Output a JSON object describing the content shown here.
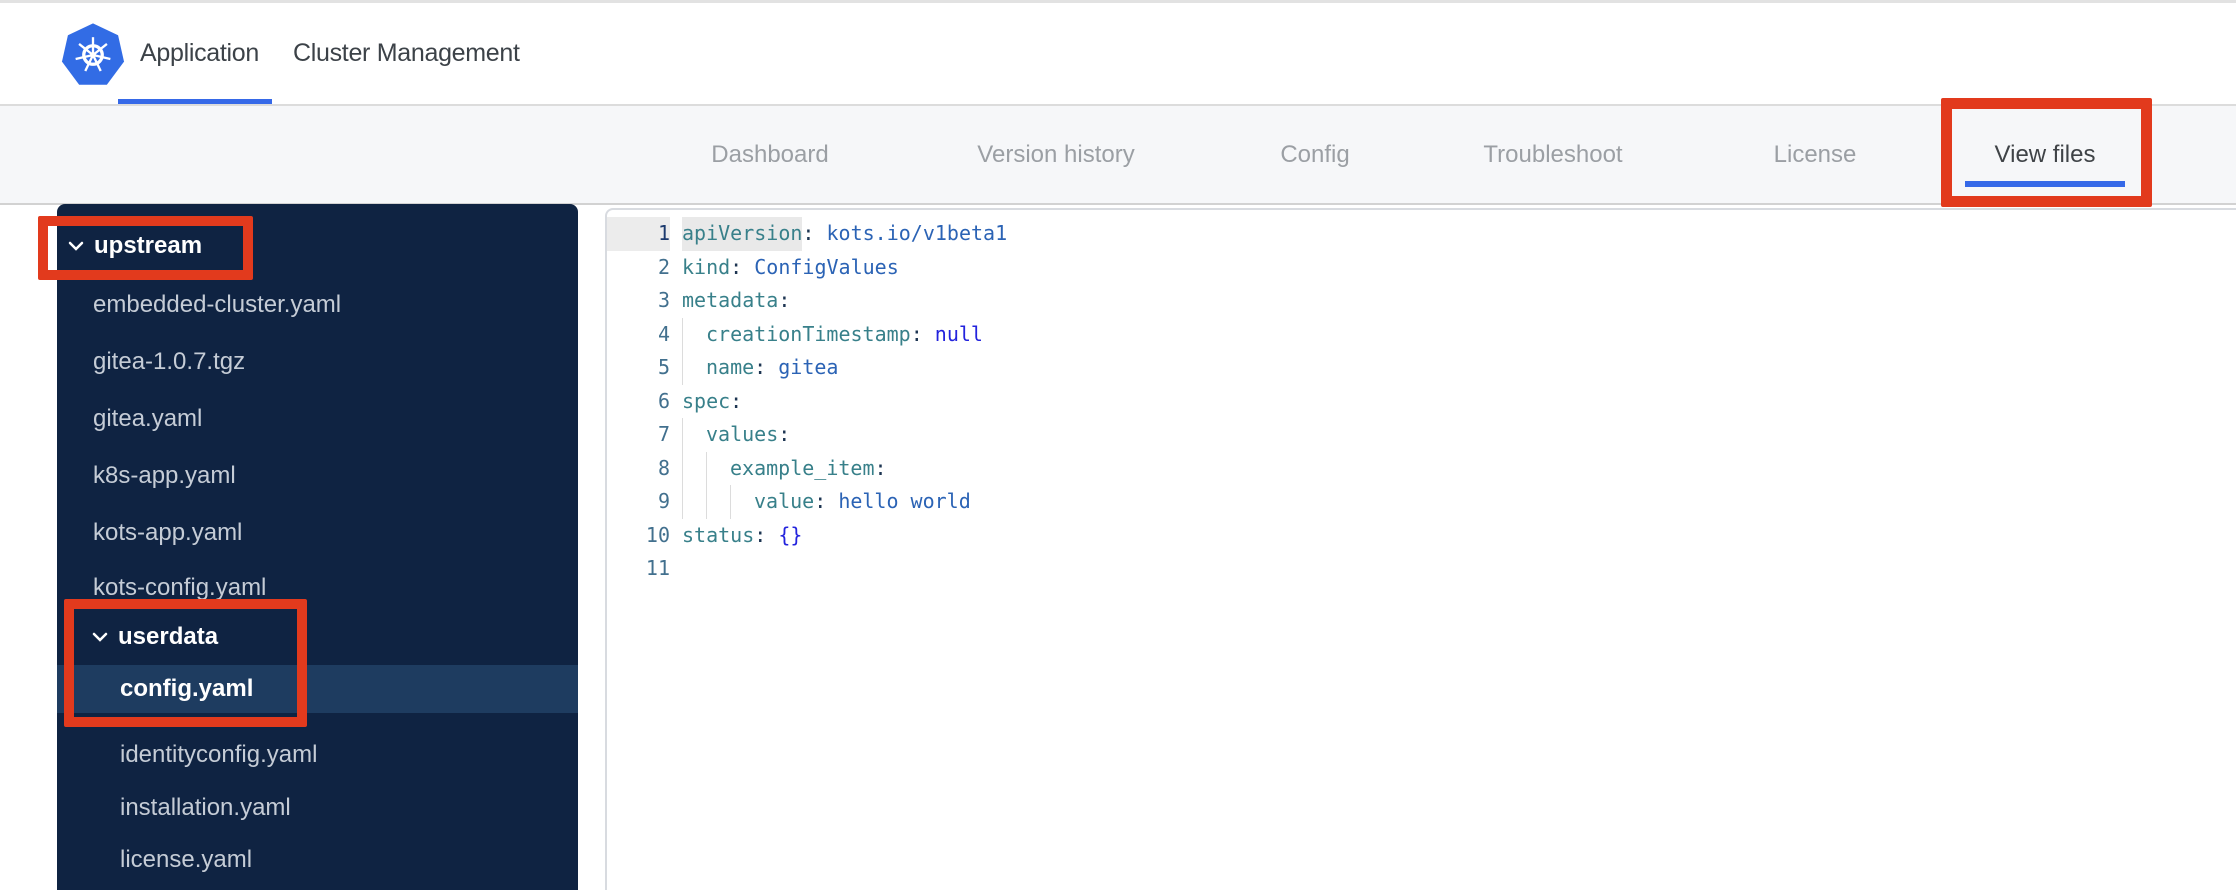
{
  "header": {
    "logo": "kubernetes-logo",
    "tabs": [
      {
        "label": "Application",
        "active": true
      },
      {
        "label": "Cluster Management",
        "active": false
      }
    ]
  },
  "subnav": {
    "tabs": [
      {
        "label": "Dashboard",
        "active": false
      },
      {
        "label": "Version history",
        "active": false
      },
      {
        "label": "Config",
        "active": false
      },
      {
        "label": "Troubleshoot",
        "active": false
      },
      {
        "label": "License",
        "active": false
      },
      {
        "label": "View files",
        "active": true,
        "annotated": true
      }
    ]
  },
  "file_tree": {
    "items": [
      {
        "label": "upstream",
        "type": "folder",
        "expanded": true,
        "annotated": true
      },
      {
        "label": "embedded-cluster.yaml",
        "type": "file"
      },
      {
        "label": "gitea-1.0.7.tgz",
        "type": "file"
      },
      {
        "label": "gitea.yaml",
        "type": "file"
      },
      {
        "label": "k8s-app.yaml",
        "type": "file"
      },
      {
        "label": "kots-app.yaml",
        "type": "file"
      },
      {
        "label": "kots-config.yaml",
        "type": "file"
      },
      {
        "label": "userdata",
        "type": "folder",
        "expanded": true,
        "annotated": true
      },
      {
        "label": "config.yaml",
        "type": "file",
        "selected": true,
        "annotated": true
      },
      {
        "label": "identityconfig.yaml",
        "type": "file"
      },
      {
        "label": "installation.yaml",
        "type": "file"
      },
      {
        "label": "license.yaml",
        "type": "file"
      }
    ]
  },
  "editor": {
    "lines": [
      {
        "n": "1",
        "key": "apiVersion",
        "sep": ": ",
        "val": "kots.io/v1beta1",
        "val_class": "tok-value",
        "active": true
      },
      {
        "n": "2",
        "key": "kind",
        "sep": ": ",
        "val": "ConfigValues",
        "val_class": "tok-value"
      },
      {
        "n": "3",
        "key": "metadata",
        "sep": ":"
      },
      {
        "n": "4",
        "key": "creationTimestamp",
        "sep": ": ",
        "val": "null",
        "val_class": "tok-special"
      },
      {
        "n": "5",
        "key": "name",
        "sep": ": ",
        "val": "gitea",
        "val_class": "tok-value"
      },
      {
        "n": "6",
        "key": "spec",
        "sep": ":"
      },
      {
        "n": "7",
        "key": "values",
        "sep": ":"
      },
      {
        "n": "8",
        "key": "example_item",
        "sep": ":"
      },
      {
        "n": "9",
        "key": "value",
        "sep": ": ",
        "val": "hello world",
        "val_class": "tok-value"
      },
      {
        "n": "10",
        "key": "status",
        "sep": ": ",
        "val": "{}",
        "val_class": "tok-special"
      },
      {
        "n": "11",
        "key": "",
        "sep": ""
      }
    ]
  },
  "colors": {
    "annotation_red": "#e23a1d",
    "accent_blue": "#3669e8",
    "kubernetes_blue": "#326ce5",
    "sidebar_bg": "#0f2342",
    "sidebar_selected_row": "#1e3c60",
    "token_key": "#38808a",
    "token_value": "#2b63b5",
    "token_special": "#2323dd"
  }
}
